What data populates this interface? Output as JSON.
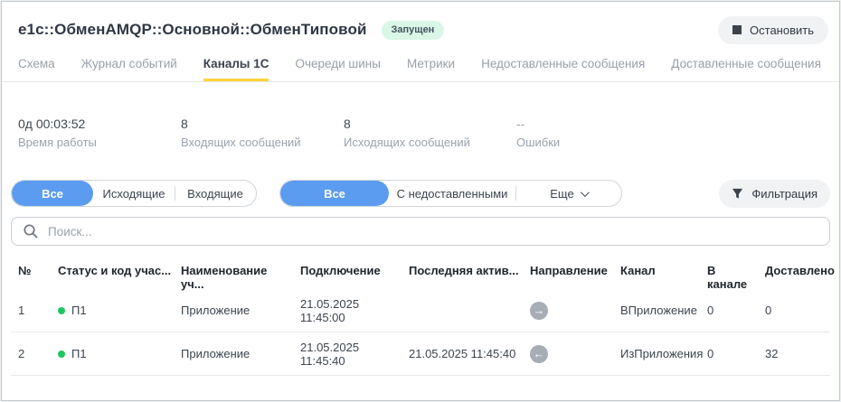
{
  "header": {
    "title": "e1c::ОбменAMQP::Основной::ОбменТиповой",
    "status_badge": "Запущен",
    "stop_button": "Остановить"
  },
  "tabs": [
    {
      "label": "Схема",
      "active": false
    },
    {
      "label": "Журнал событий",
      "active": false
    },
    {
      "label": "Каналы 1С",
      "active": true
    },
    {
      "label": "Очереди шины",
      "active": false
    },
    {
      "label": "Метрики",
      "active": false
    },
    {
      "label": "Недоставленные сообщения",
      "active": false
    },
    {
      "label": "Доставленные сообщения",
      "active": false
    }
  ],
  "stats": [
    {
      "value": "0д 00:03:52",
      "label": "Время работы"
    },
    {
      "value": "8",
      "label": "Входящих сообщений"
    },
    {
      "value": "8",
      "label": "Исходящих сообщений"
    },
    {
      "value": "--",
      "label": "Ошибки",
      "muted": true
    }
  ],
  "filters": {
    "direction_group": [
      {
        "label": "Все",
        "active": true
      },
      {
        "label": "Исходящие",
        "active": false
      },
      {
        "label": "Входящие",
        "active": false
      }
    ],
    "delivery_group": [
      {
        "label": "Все",
        "active": true
      },
      {
        "label": "С недоставленными",
        "active": false
      },
      {
        "label": "Еще",
        "active": false,
        "has_chevron": true
      }
    ],
    "filter_button": "Фильтрация"
  },
  "search": {
    "placeholder": "Поиск..."
  },
  "table": {
    "columns": [
      "№",
      "Статус и код учас...",
      "Наименование уч...",
      "Подключение",
      "Последняя актив...",
      "Направление",
      "Канал",
      "В канале",
      "Доставлено"
    ],
    "rows": [
      {
        "num": "1",
        "status_code": "П1",
        "status_color": "#1fc662",
        "name": "Приложение",
        "connection": "21.05.2025 11:45:00",
        "last_activity": "",
        "direction": "right",
        "direction_arrow": "→",
        "channel": "ВПриложение",
        "in_channel": "0",
        "delivered": "0"
      },
      {
        "num": "2",
        "status_code": "П1",
        "status_color": "#1fc662",
        "name": "Приложение",
        "connection": "21.05.2025 11:45:40",
        "last_activity": "21.05.2025 11:45:40",
        "direction": "left",
        "direction_arrow": "←",
        "channel": "ИзПриложения",
        "in_channel": "0",
        "delivered": "32"
      }
    ]
  },
  "colors": {
    "accent_blue": "#5b9bf0",
    "tab_underline_yellow": "#ffd43b",
    "badge_green_bg": "#d9f6e7",
    "status_green": "#1fc662",
    "button_gray_bg": "#f1f2f4"
  }
}
